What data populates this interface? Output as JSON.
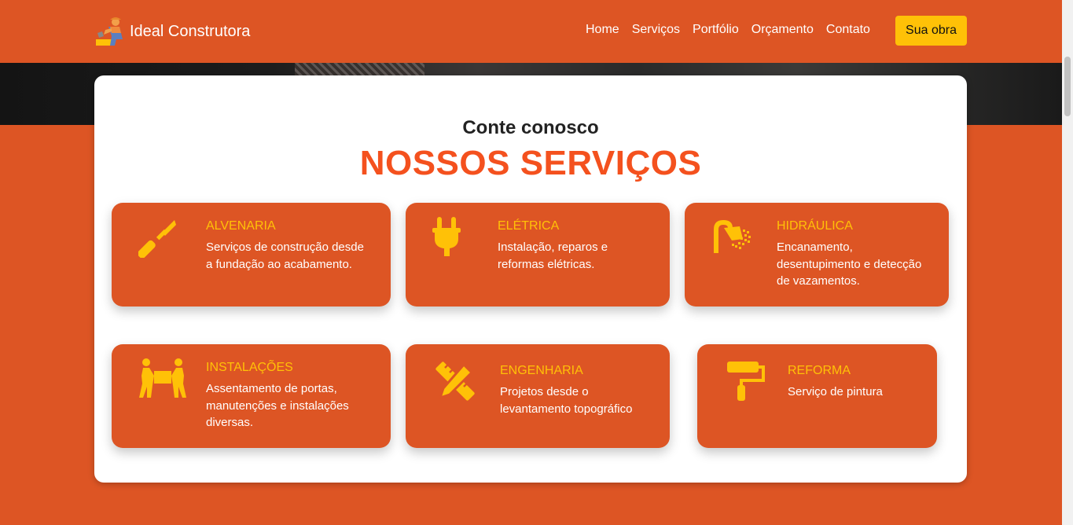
{
  "brand": {
    "name": "Ideal Construtora",
    "logo_icon": "construction-worker-icon"
  },
  "nav": {
    "links": [
      "Home",
      "Serviços",
      "Portfólio",
      "Orçamento",
      "Contato"
    ],
    "cta_label": "Sua obra"
  },
  "section": {
    "eyebrow": "Conte conosco",
    "title": "NOSSOS SERVIÇOS"
  },
  "services": [
    {
      "title": "ALVENARIA",
      "description": "Serviços de construção desde a fundação ao acabamento.",
      "icon": "trowel-icon"
    },
    {
      "title": "ELÉTRICA",
      "description": "Instalação, reparos e reformas elétricas.",
      "icon": "plug-icon"
    },
    {
      "title": "HIDRÁULICA",
      "description": "Encanamento, desentupimento e detecção de vazamentos.",
      "icon": "shower-icon"
    },
    {
      "title": "INSTALAÇÕES",
      "description": "Assentamento de portas, manutenções e instalações diversas.",
      "icon": "people-carry-icon"
    },
    {
      "title": "ENGENHARIA",
      "description": "Projetos desde o levantamento topográfico",
      "icon": "pencil-ruler-icon"
    },
    {
      "title": "REFORMA",
      "description": "Serviço de pintura",
      "icon": "paint-roller-icon"
    }
  ],
  "colors": {
    "primary": "#dd5524",
    "accent": "#ffc107",
    "title": "#f4511e",
    "panel": "#ffffff"
  }
}
